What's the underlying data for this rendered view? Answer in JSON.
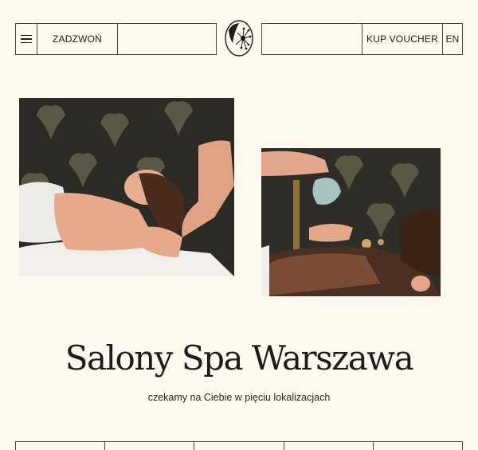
{
  "nav": {
    "menu_icon": "hamburger-menu-icon",
    "call_label": "ZADZWOŃ",
    "voucher_label": "KUP VOUCHER",
    "lang_label": "EN",
    "logo_icon": "flower-logo-icon"
  },
  "hero": {
    "title": "Salony Spa Warszawa",
    "subtitle": "czekamy na Ciebie w pięciu lokalizacjach"
  },
  "colors": {
    "background": "#fdf9ef",
    "text": "#1e1c1a",
    "border": "#4a4642"
  }
}
